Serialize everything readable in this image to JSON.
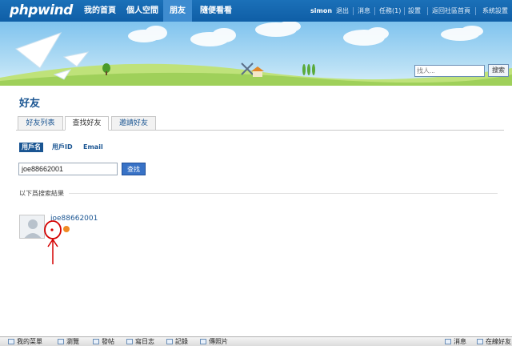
{
  "app": {
    "logo": "phpwind"
  },
  "nav": [
    {
      "label": "我的首頁"
    },
    {
      "label": "個人空間"
    },
    {
      "label": "朋友"
    },
    {
      "label": "隨便看看"
    }
  ],
  "user": {
    "name": "simon",
    "links": [
      "退出",
      "消息",
      "任務(1)",
      "設置",
      "返回社區首頁",
      "系統設置"
    ]
  },
  "search": {
    "placeholder": "找人...",
    "button": "搜索"
  },
  "page": {
    "title": "好友"
  },
  "tabs": [
    {
      "label": "好友列表"
    },
    {
      "label": "查找好友"
    },
    {
      "label": "邀請好友"
    }
  ],
  "filters": [
    {
      "label": "用戶名"
    },
    {
      "label": "用戶ID"
    },
    {
      "label": "Email"
    }
  ],
  "query": {
    "value": "joe88662001",
    "button": "查找"
  },
  "results": {
    "label": "以下爲搜索結果",
    "items": [
      {
        "name": "joe88662001"
      }
    ]
  },
  "bottom": {
    "left": [
      "我的菜單",
      "瀏覽",
      "發帖",
      "寫日志",
      "記錄",
      "傳照片"
    ],
    "right": [
      "消息",
      "在線好友"
    ]
  },
  "colors": {
    "nav": "#1468b0",
    "accent": "#1a5592",
    "button": "#3872c6",
    "annotation": "#d40000"
  }
}
